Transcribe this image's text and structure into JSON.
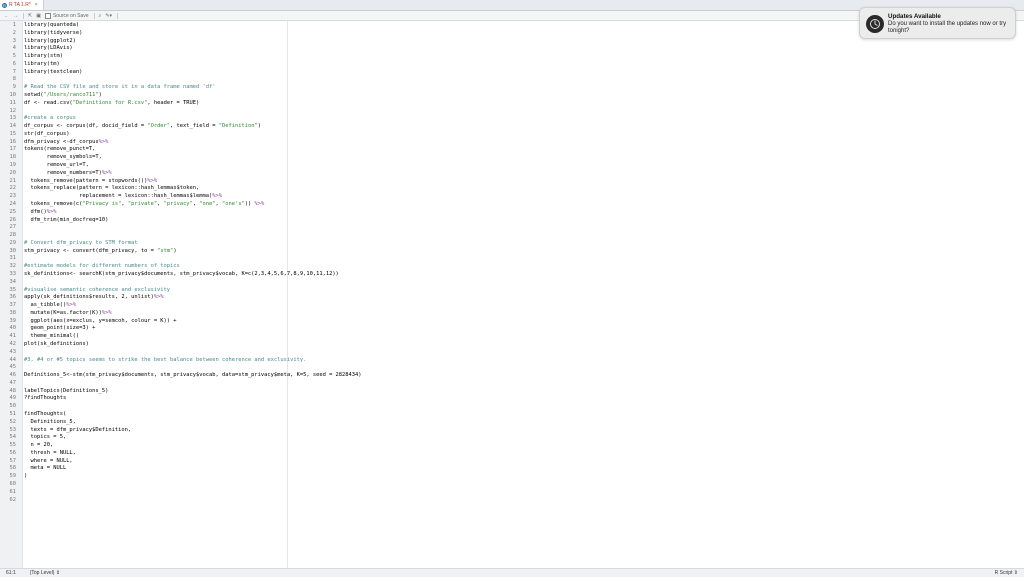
{
  "tab": {
    "title": "R TA 1.R*",
    "close": "×"
  },
  "toolbar": {
    "source_on_save": "Source on Save"
  },
  "notification": {
    "title": "Updates Available",
    "body": "Do you want to install the updates now or try tonight?"
  },
  "status": {
    "position": "61:1",
    "scope": "(Top Level) ⇕",
    "filetype": "R Script ⇕"
  },
  "lines": [
    "library(quanteda)",
    "library(tidyverse)",
    "library(ggplot2)",
    "library(LDAvis)",
    "library(stm)",
    "library(tm)",
    "library(textclean)",
    "",
    "# Read the CSV file and store it in a data frame named 'df'",
    "setwd(\"/Users/ranco711\")",
    "df <- read.csv(\"Definitions for R.csv\", header = TRUE)",
    "",
    "#create a corpus",
    "df_corpus <- corpus(df, docid_field = \"Order\", text_field = \"Definition\")",
    "str(df_corpus)",
    "dfm_privacy <-df_corpus%>%",
    "tokens(remove_punct=T,",
    "       remove_symbols=T,",
    "       remove_url=T,",
    "       remove_numbers=T)%>%",
    "  tokens_remove(pattern = stopwords())%>%",
    "  tokens_replace(pattern = lexicon::hash_lemmas$token,",
    "                 replacement = lexicon::hash_lemmas$lemma)%>%",
    "  tokens_remove(c(\"Privacy is\", \"private\", \"privacy\", \"one\", \"one's\")) %>%",
    "  dfm()%>%",
    "  dfm_trim(min_docfreq=10)",
    "",
    "",
    "# Convert dfm_privacy to STM format",
    "stm_privacy <- convert(dfm_privacy, to = \"stm\")",
    "",
    "#estimate models for different numbers of topics",
    "sk_definitions<- searchK(stm_privacy$documents, stm_privacy$vocab, K=c(2,3,4,5,6,7,8,9,10,11,12))",
    "",
    "#visualise semantic coherence and exclusivity",
    "apply(sk_definitions$results, 2, unlist)%>%",
    "  as_tibble()%>%",
    "  mutate(K=as.factor(K))%>%",
    "  ggplot(aes(x=exclus, y=semcoh, colour = K)) +",
    "  geom_point(size=3) +",
    "  theme_minimal()",
    "plot(sk_definitions)",
    "",
    "#3, #4 or #5 topics seems to strike the best balance between coherence and exclusivity.",
    "",
    "Definitions_5<-stm(stm_privacy$documents, stm_privacy$vocab, data=stm_privacy$meta, K=5, seed = 2828434)",
    "",
    "labelTopics(Definitions_5)",
    "?findThoughts",
    "",
    "findThoughts(",
    "  Definitions_5,",
    "  texts = dfm_privacy$Definition,",
    "  topics = 5,",
    "  n = 20,",
    "  thresh = NULL,",
    "  where = NULL,",
    "  meta = NULL",
    ")",
    "",
    "",
    ""
  ],
  "line_numbers": [
    "1",
    "2",
    "3",
    "4",
    "5",
    "6",
    "7",
    "8",
    "9",
    "10",
    "11",
    "12",
    "13",
    "14",
    "15",
    "16",
    "17",
    "18",
    "19",
    "20",
    "21",
    "22",
    "23",
    "24",
    "25",
    "26",
    "27",
    "28",
    "29",
    "30",
    "31",
    "32",
    "33",
    "34",
    "35",
    "36",
    "37",
    "38",
    "39",
    "40",
    "41",
    "42",
    "43",
    "44",
    "45",
    "46",
    "47",
    "48",
    "49",
    "50",
    "51",
    "52",
    "53",
    "54",
    "55",
    "56",
    "57",
    "58",
    "59",
    "60",
    "61",
    "62"
  ]
}
